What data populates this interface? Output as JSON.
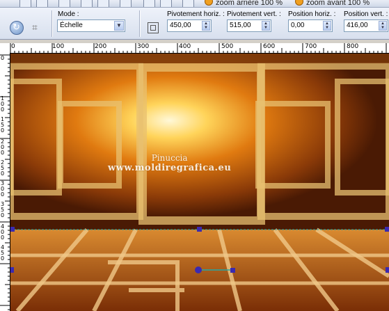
{
  "toolbar": {
    "zoom_out_label": "zoom arrière 100 %",
    "zoom_in_label": "zoom avant 100 %"
  },
  "options": {
    "mode_label": "Mode :",
    "mode_value": "Échelle",
    "pivot_h_label": "Pivotement horiz. :",
    "pivot_h_value": "450,00",
    "pivot_v_label": "Pivotement vert. :",
    "pivot_v_value": "515,00",
    "pos_h_label": "Position horiz. :",
    "pos_h_value": "0,00",
    "pos_v_label": "Position vert. :",
    "pos_v_value": "416,00"
  },
  "ruler": {
    "top_labels": [
      "0",
      "100",
      "200",
      "300",
      "400",
      "500",
      "600",
      "700",
      "800"
    ],
    "left_labels": [
      "0",
      "1\n0\n0",
      "1\n5\n0",
      "2\n0\n0",
      "2\n5\n0",
      "3\n0\n0",
      "3\n5\n0",
      "4\n0\n0",
      "4\n5\n0"
    ]
  },
  "canvas": {
    "watermark_name": "Pinuccia",
    "watermark_url": "www.moldiregrafica.eu"
  }
}
